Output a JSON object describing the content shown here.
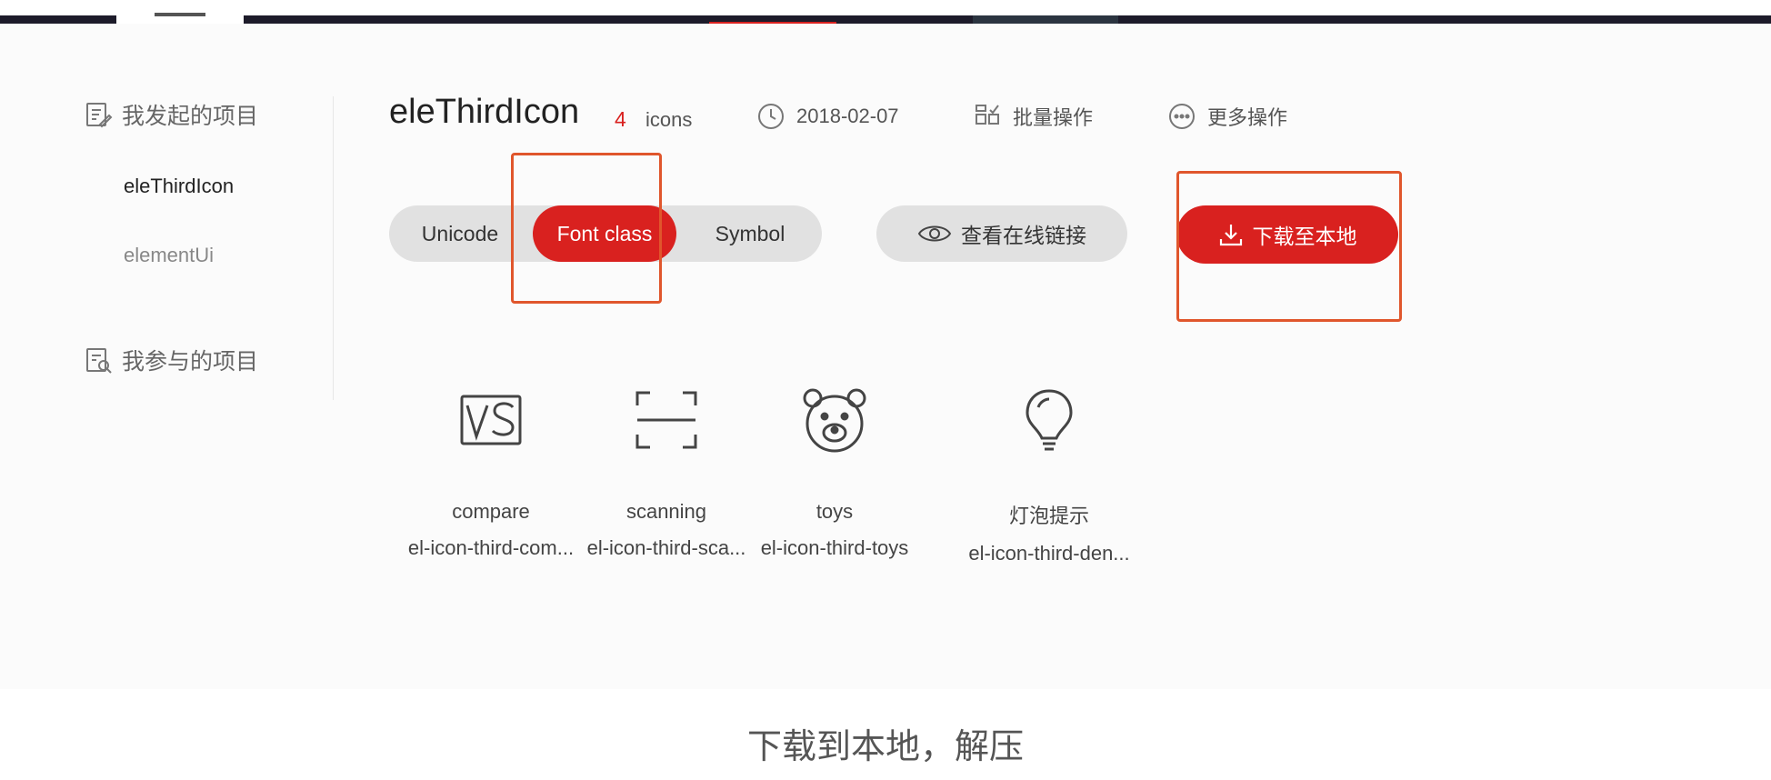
{
  "sidebar": {
    "my_projects_label": "我发起的项目",
    "projects": [
      "eleThirdIcon",
      "elementUi"
    ],
    "joined_projects_label": "我参与的项目"
  },
  "project": {
    "title": "eleThirdIcon",
    "icon_count": "4",
    "icon_unit": "icons",
    "date": "2018-02-07",
    "batch_label": "批量操作",
    "more_label": "更多操作"
  },
  "tabs": {
    "items": [
      "Unicode",
      "Font class",
      "Symbol"
    ],
    "selected": "Font class"
  },
  "buttons": {
    "view_online": "查看在线链接",
    "download": "下载至本地"
  },
  "icons": [
    {
      "name": "compare",
      "code": "el-icon-third-com..."
    },
    {
      "name": "scanning",
      "code": "el-icon-third-sca..."
    },
    {
      "name": "toys",
      "code": "el-icon-third-toys"
    },
    {
      "name": "灯泡提示",
      "code": "el-icon-third-den..."
    }
  ],
  "caption": "下载到本地，解压",
  "colors": {
    "accent": "#d9211f",
    "highlight": "#e0562c",
    "pill": "#e1e1e1"
  }
}
